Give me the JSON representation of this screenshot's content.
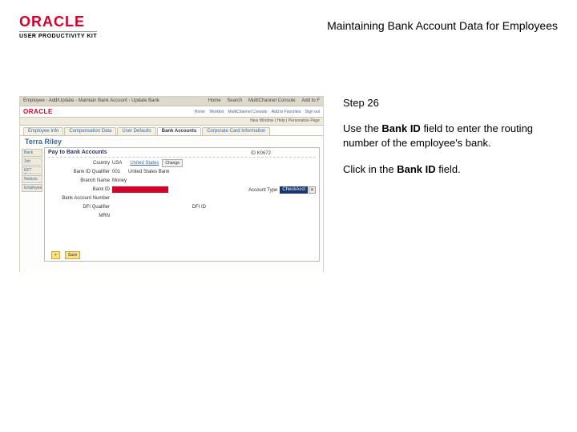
{
  "header": {
    "logo_text": "ORACLE",
    "logo_sub": "USER PRODUCTIVITY KIT",
    "doc_title": "Maintaining Bank Account Data for Employees"
  },
  "instructions": {
    "step_label": "Step 26",
    "para1_pre": "Use the ",
    "para1_bold": "Bank ID",
    "para1_post": " field to enter the routing number of the employee's bank.",
    "para2_pre": "Click in the ",
    "para2_bold": "Bank ID",
    "para2_post": " field."
  },
  "screenshot": {
    "breadcrumbs": [
      "Employee",
      "Add/Update",
      "Maintain Bank Account",
      "Update Bank"
    ],
    "top_links": [
      "Home",
      "Search",
      "MultiChannel Console",
      "Add to F"
    ],
    "bar2_brand": "ORACLE",
    "bar2_links": [
      "Home",
      "Worklist",
      "MultiChannel Console",
      "Add to Favorites",
      "Sign out"
    ],
    "bar3": "New Window | Help | Personalize Page",
    "tabs": [
      "Employee Info",
      "Compensation Data",
      "User Defaults",
      "Bank Accounts",
      "Corporate Card Information"
    ],
    "active_tab": 3,
    "person_name": "Terra Riley",
    "side_items": [
      "Back",
      "Job",
      "EFT Optio",
      "Notices",
      "Employee"
    ],
    "form": {
      "title": "Pay to Bank Accounts",
      "id_label": "ID K0672",
      "country_label": "Country",
      "country_value": "USA",
      "country_link": "United States",
      "country_btn": "Change",
      "bank_id_qual_label": "Bank ID Qualifier",
      "bank_id_qual_value": "001",
      "bank_id_qual_desc": "United States Bank",
      "branch_name_label": "Branch Name",
      "branch_name_value": "Money",
      "bank_id_label": "Bank ID",
      "bank_acct_num_label": "Bank Account Number",
      "dfi_qual_label": "DFI Qualifier",
      "dfi_id_label": "DFI ID",
      "account_type_label": "Account Type",
      "account_type_value": "CheckAcct",
      "mrn_label": "MRN",
      "btn_add": "+",
      "btn_save": "Save"
    }
  }
}
